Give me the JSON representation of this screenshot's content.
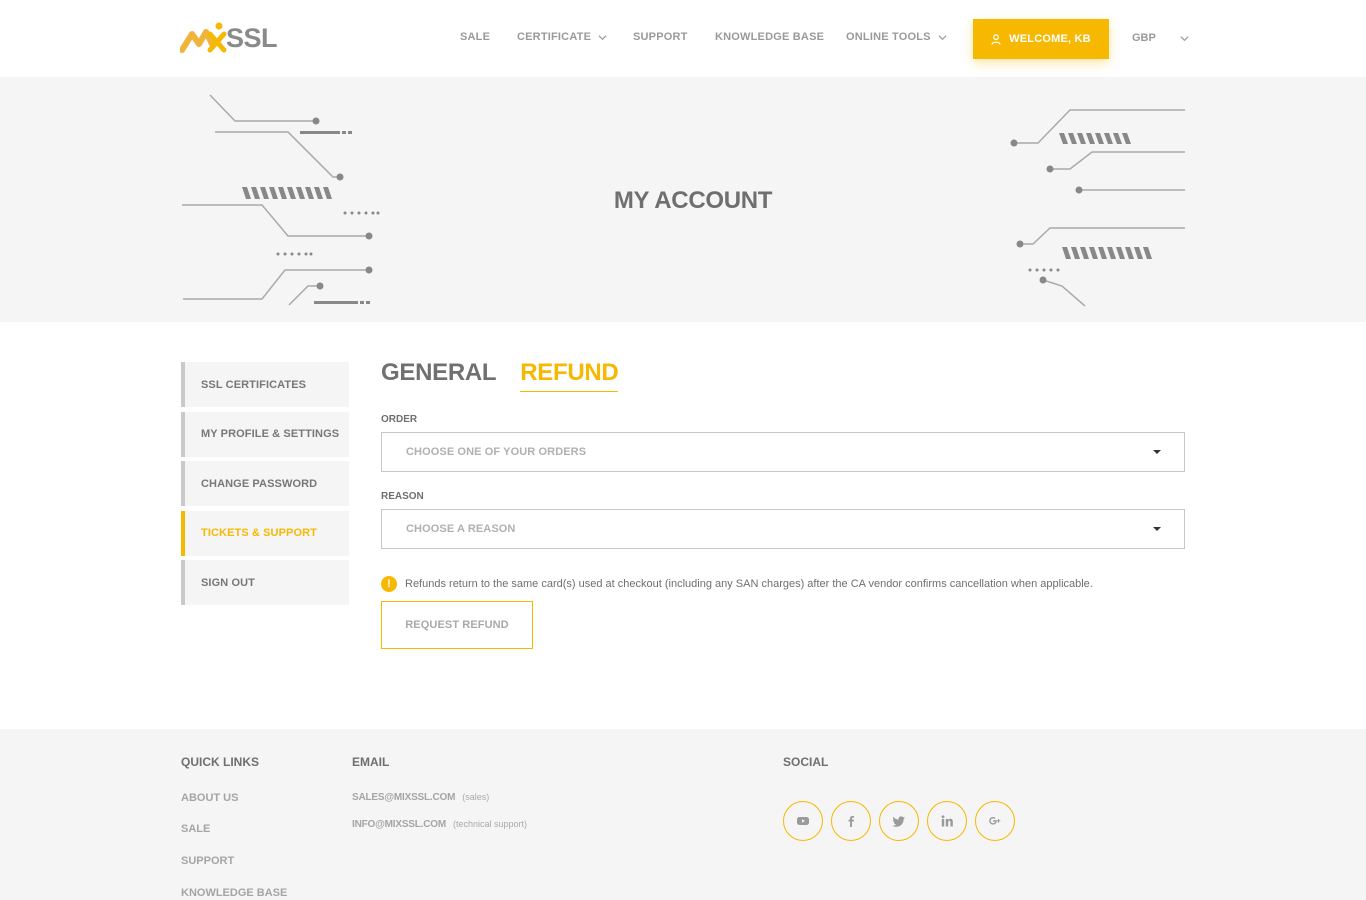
{
  "header": {
    "logo_text": "SSL",
    "nav": [
      {
        "label": "SALE"
      },
      {
        "label": "CERTIFICATE"
      },
      {
        "label": "SUPPORT"
      },
      {
        "label": "KNOWLEDGE BASE"
      },
      {
        "label": "ONLINE TOOLS"
      }
    ],
    "welcome_label": "WELCOME, KB",
    "currency": "GBP"
  },
  "hero": {
    "title": "MY ACCOUNT"
  },
  "sidebar": {
    "items": [
      {
        "label": "SSL CERTIFICATES"
      },
      {
        "label": "MY PROFILE & SETTINGS"
      },
      {
        "label": "CHANGE PASSWORD"
      },
      {
        "label": "TICKETS & SUPPORT"
      },
      {
        "label": "SIGN OUT"
      }
    ],
    "active_index": 3
  },
  "main": {
    "tabs": [
      {
        "label": "GENERAL"
      },
      {
        "label": "REFUND"
      }
    ],
    "order": {
      "label": "ORDER",
      "placeholder": "CHOOSE ONE OF YOUR ORDERS"
    },
    "reason": {
      "label": "REASON",
      "placeholder": "CHOOSE A REASON"
    },
    "info_glyph": "!",
    "notice": "Refunds return to the same card(s) used at checkout (including any SAN charges) after the CA vendor confirms cancellation when applicable.",
    "submit_label": "REQUEST REFUND"
  },
  "footer": {
    "quick_links_title": "QUICK LINKS",
    "quick_links": [
      {
        "label": "ABOUT US"
      },
      {
        "label": "SALE"
      },
      {
        "label": "SUPPORT"
      },
      {
        "label": "KNOWLEDGE BASE"
      }
    ],
    "email_title": "EMAIL",
    "emails": [
      {
        "address": "SALES@MIXSSL.COM",
        "note": "(sales)"
      },
      {
        "address": "INFO@MIXSSL.COM",
        "note": "(technical support)"
      }
    ],
    "social_title": "SOCIAL",
    "social_icons": [
      "youtube-icon",
      "facebook-icon",
      "twitter-icon",
      "linkedin-icon",
      "google-plus-icon"
    ]
  },
  "colors": {
    "accent": "#f6b800",
    "text": "#7a7a7a",
    "panel": "#f5f5f5"
  }
}
